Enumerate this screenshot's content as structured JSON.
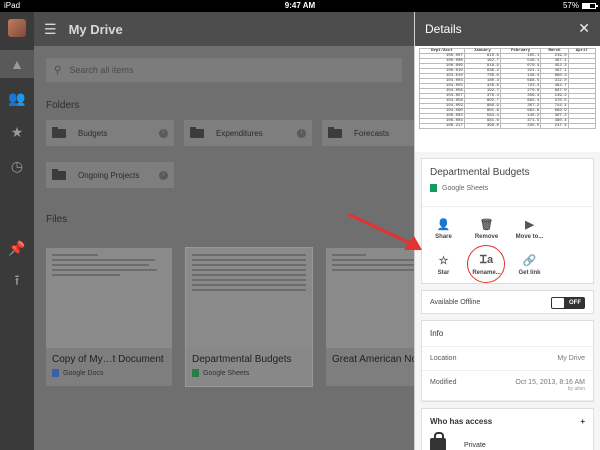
{
  "statusbar": {
    "device": "iPad",
    "time": "9:47 AM",
    "battery": "57%",
    "battery_level": 0.57
  },
  "app": {
    "title": "My Drive",
    "search_placeholder": "Search all items"
  },
  "sections": {
    "folders": "Folders",
    "files": "Files"
  },
  "folders": [
    "Budgets",
    "Expenditures",
    "Forecasts",
    "Ongoing Projects"
  ],
  "files": [
    {
      "name": "Copy of My…t Document",
      "type": "Google Docs"
    },
    {
      "name": "Departmental Budgets",
      "type": "Google Sheets"
    },
    {
      "name": "Great American No",
      "type": ""
    }
  ],
  "details": {
    "title": "Details",
    "preview_headers": [
      "Dept/Acct",
      "January",
      "February",
      "March",
      "April"
    ],
    "preview_rows": [
      [
        "100-007",
        "910.6",
        "105.1",
        "219.0"
      ],
      [
        "100-008",
        "162.7",
        "546.1",
        "467.1"
      ],
      [
        "100-009",
        "918.9",
        "670.4",
        "452.3"
      ],
      [
        "100-010",
        "936.2",
        "321.1",
        "467.1"
      ],
      [
        "103-010",
        "730.0",
        "138.4",
        "660.3"
      ],
      [
        "104-003",
        "180.4",
        "698.5",
        "312.0"
      ],
      [
        "104-055",
        "426.6",
        "722.4",
        "464.7"
      ],
      [
        "104-056",
        "192.7",
        "270.6",
        "667.0"
      ],
      [
        "104-057",
        "376.4",
        "356.4",
        "149.2"
      ],
      [
        "104-058",
        "802.7",
        "682.4",
        "370.5"
      ],
      [
        "104-059",
        "889.9",
        "367.2",
        "744.4"
      ],
      [
        "104-060",
        "801.6",
        "662.6",
        "660.9"
      ],
      [
        "106-002",
        "584.4",
        "140.2",
        "307.2"
      ],
      [
        "106-003",
        "961.6",
        "371.5",
        "490.4"
      ],
      [
        "106-217",
        "398.0",
        "335.5",
        "247.4"
      ]
    ],
    "doc_name": "Departmental Budgets",
    "doc_type": "Google Sheets",
    "actions": [
      "Share",
      "Remove",
      "Move to...",
      "Star",
      "Rename...",
      "Get link"
    ],
    "available_offline": "Available Offline",
    "offline_toggle": "OFF",
    "info_header": "Info",
    "location_label": "Location",
    "location_value": "My Drive",
    "modified_label": "Modified",
    "modified_value": "Oct 15, 2013, 8:16 AM",
    "modified_by": "by allen",
    "access_header": "Who has access",
    "access_plus": "+",
    "access_private": "Private"
  },
  "colors": {
    "sheets_green": "#0f9d58",
    "docs_blue": "#4285f4",
    "annotation_red": "#e5312f"
  }
}
